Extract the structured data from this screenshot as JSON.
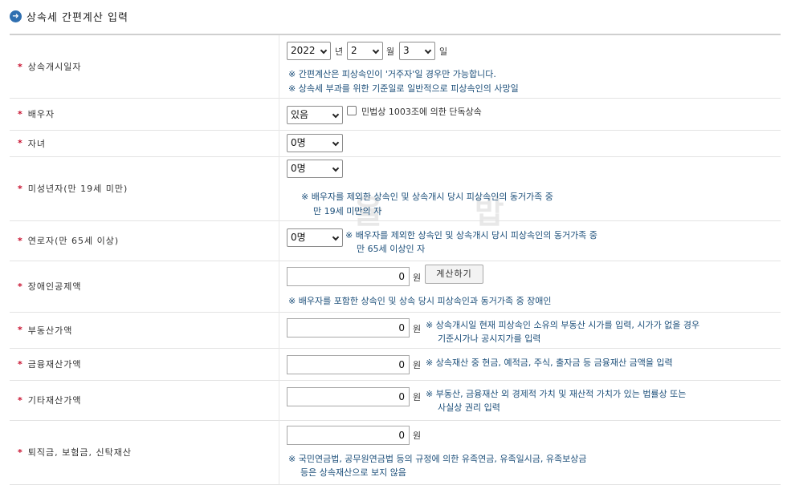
{
  "header": {
    "icon": "arrow-right-circle-icon",
    "title": "상속세 간편계산 입력"
  },
  "watermark": "율 밥",
  "rows": {
    "start_date": {
      "label": "상속개시일자",
      "year": "2022",
      "year_unit": "년",
      "month": "2",
      "month_unit": "월",
      "day": "3",
      "day_unit": "일",
      "note1": "※ 간편계산은 피상속인이 '거주자'일 경우만 가능합니다.",
      "note2": "※ 상속세 부과를 위한 기준일로 일반적으로 피상속인의 사망일"
    },
    "spouse": {
      "label": "배우자",
      "value": "있음",
      "checkbox_label": "민법상 1003조에 의한 단독상속"
    },
    "children": {
      "label": "자녀",
      "value": "0명"
    },
    "minors": {
      "label": "미성년자(만 19세 미만)",
      "value": "0명",
      "note1": "※ 배우자를 제외한 상속인 및 상속개시 당시 피상속인의 동거가족 중",
      "note2": "만 19세 미만의 자"
    },
    "elderly": {
      "label": "연로자(만 65세 이상)",
      "value": "0명",
      "note1": "※ 배우자를 제외한 상속인 및 상속개시 당시 피상속인의 동거가족 중",
      "note2": "만 65세 이상인 자"
    },
    "disabled": {
      "label": "장애인공제액",
      "value": "0",
      "unit": "원",
      "button": "계산하기",
      "note": "※ 배우자를 포함한 상속인 및 상속 당시 피상속인과 동거가족 중 장애인"
    },
    "real_estate": {
      "label": "부동산가액",
      "value": "0",
      "unit": "원",
      "note1": "※ 상속개시일 현재 피상속인 소유의 부동산 시가를 입력, 시가가 없을 경우",
      "note2": "기준시가나 공시지가를 입력"
    },
    "financial": {
      "label": "금융재산가액",
      "value": "0",
      "unit": "원",
      "note": "※ 상속재산 중 현금, 예적금, 주식, 출자금 등 금융재산 금액을 입력"
    },
    "other": {
      "label": "기타재산가액",
      "value": "0",
      "unit": "원",
      "note1": "※ 부동산, 금융재산 외 경제적 가치 및 재산적 가치가 있는 법률상 또는",
      "note2": "사실상 권리 입력"
    },
    "retirement": {
      "label": "퇴직금, 보험금, 신탁재산",
      "value": "0",
      "unit": "원",
      "note1": "※ 국민연금법, 공무원연금법 등의 규정에 의한 유족연금, 유족일시금, 유족보상금",
      "note2": "등은 상속재산으로 보지 않음"
    }
  }
}
